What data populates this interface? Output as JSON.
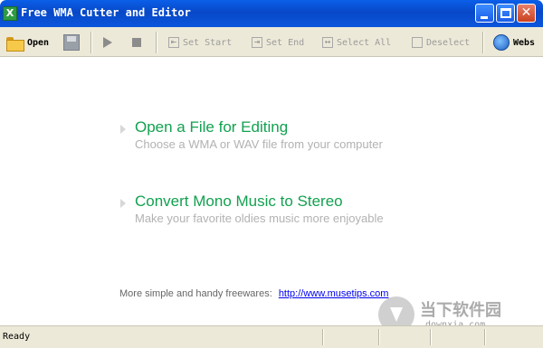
{
  "window": {
    "title": "Free WMA Cutter and Editor",
    "app_icon": "X"
  },
  "toolbar": {
    "open_label": "Open",
    "set_start_label": "Set Start",
    "set_end_label": "Set End",
    "select_all_label": "Select All",
    "deselect_label": "Deselect",
    "website_label": "Webs"
  },
  "main": {
    "items": [
      {
        "title": "Open a File for Editing",
        "subtitle": "Choose a WMA or WAV file from your computer"
      },
      {
        "title": "Convert Mono Music to Stereo",
        "subtitle": "Make your favorite oldies music more enjoyable"
      }
    ],
    "footer_text": "More simple and handy freewares:",
    "footer_link": "http://www.musetips.com"
  },
  "status": {
    "text": "Ready"
  },
  "watermark": {
    "main": "当下软件园",
    "sub": "downxia.com"
  },
  "colors": {
    "title_bar": "#0848c8",
    "accent_green": "#12a150",
    "subtitle_gray": "#b2b2b2",
    "link_blue": "#0000ee",
    "chrome": "#ece9d8"
  }
}
